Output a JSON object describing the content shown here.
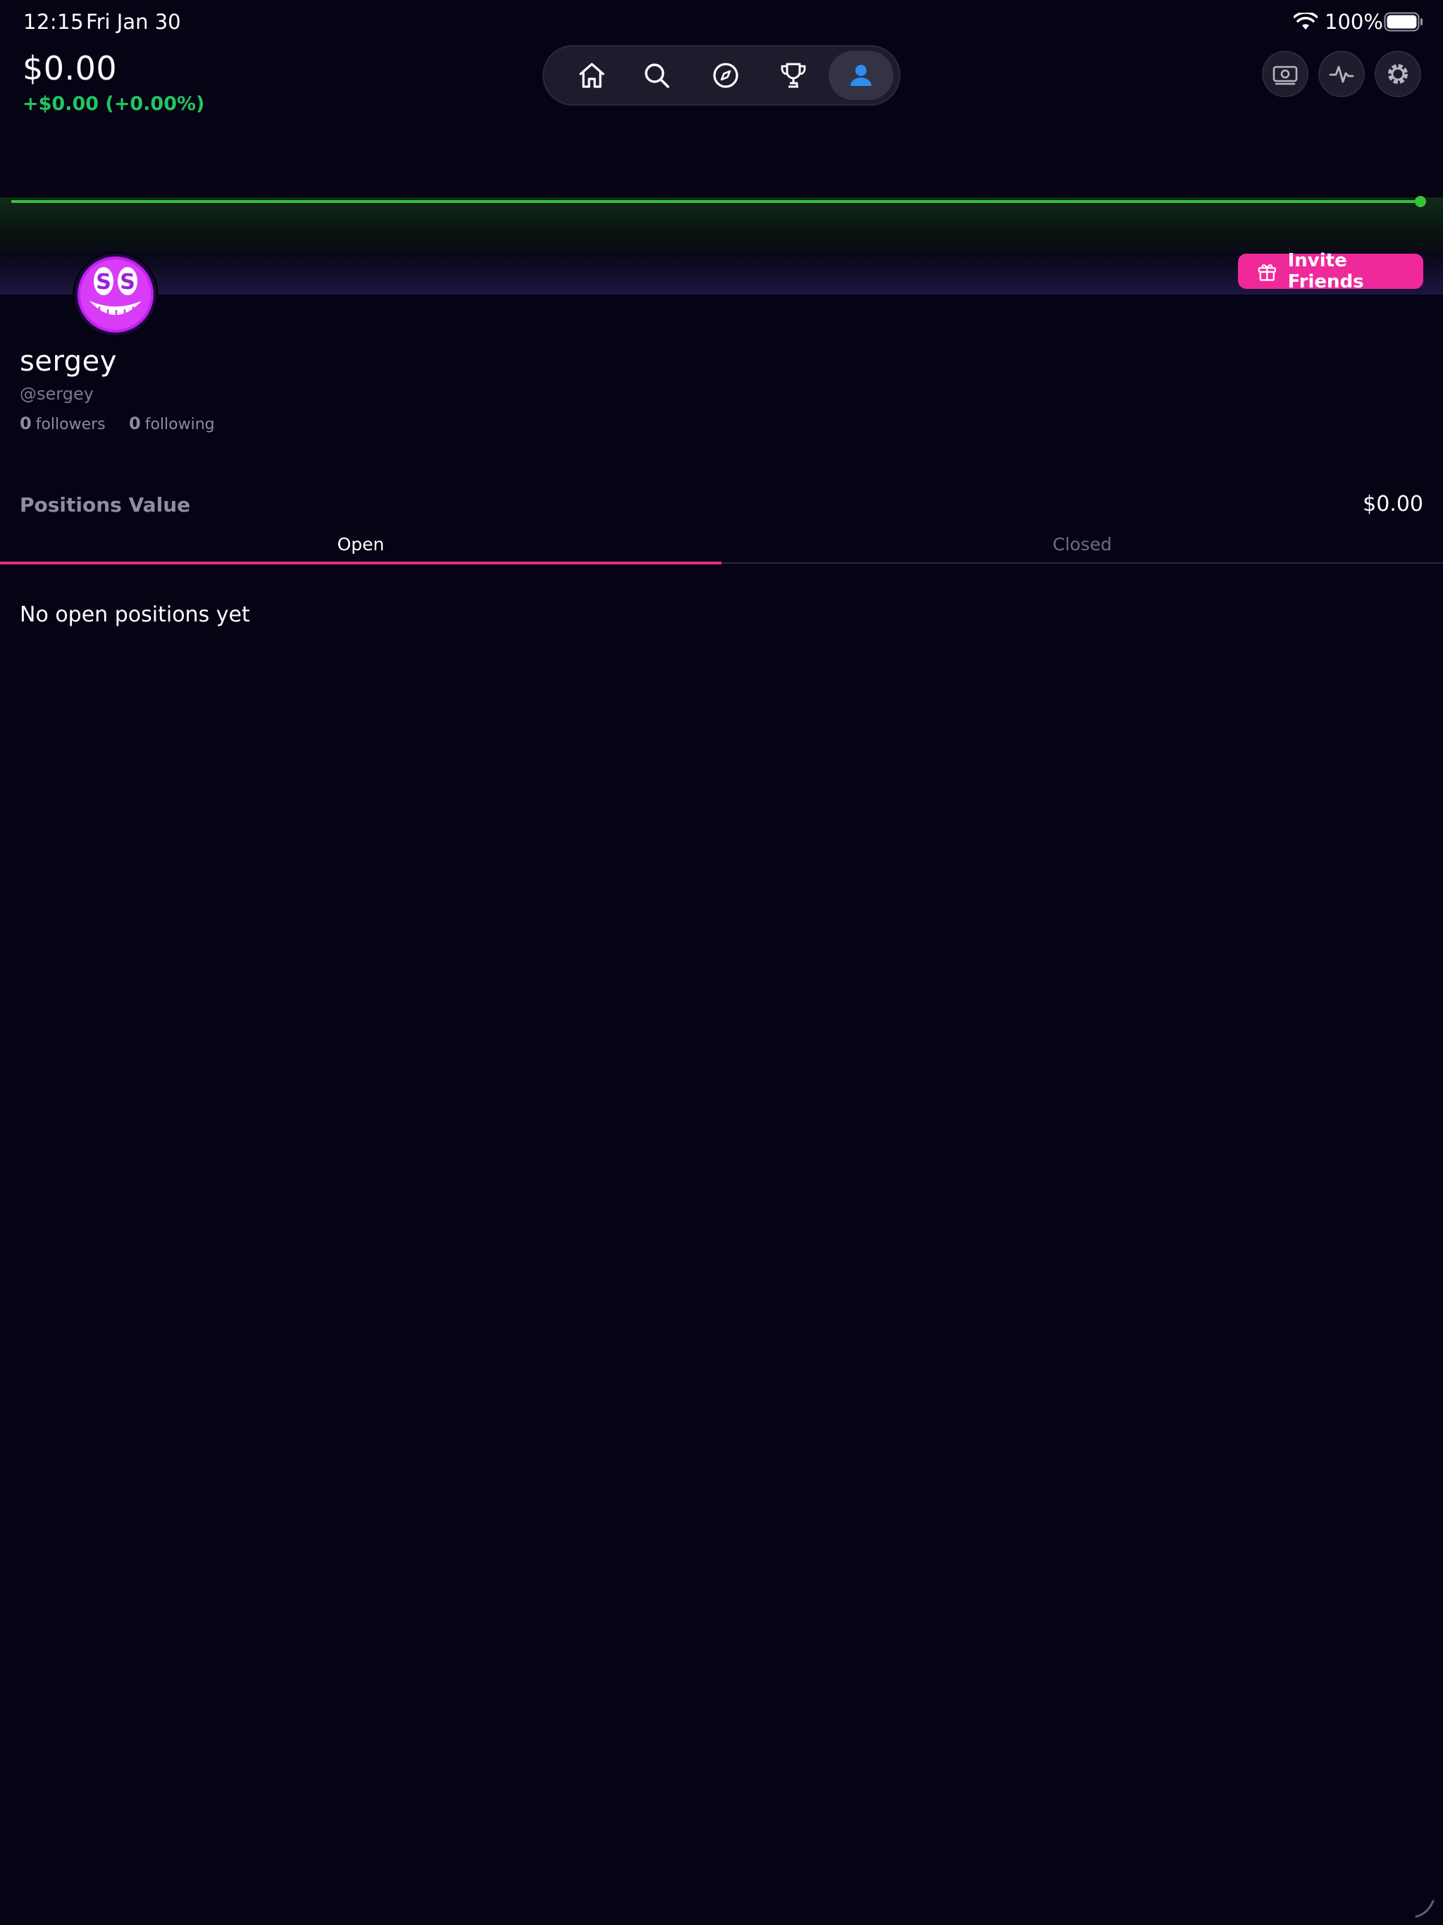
{
  "status_bar": {
    "time": "12:15",
    "date": "Fri Jan 30",
    "battery_pct": "100%"
  },
  "portfolio": {
    "balance": "$0.00",
    "change": "+$0.00 (+0.00%)",
    "change_color": "#22c55e"
  },
  "nav": {
    "items": [
      {
        "icon": "home-icon"
      },
      {
        "icon": "search-icon"
      },
      {
        "icon": "compass-icon"
      },
      {
        "icon": "trophy-icon"
      },
      {
        "icon": "profile-icon",
        "active": true
      }
    ],
    "active_color": "#2b8ef0"
  },
  "header_actions": [
    {
      "icon": "cash-icon"
    },
    {
      "icon": "activity-icon"
    },
    {
      "icon": "gear-icon"
    }
  ],
  "invite": {
    "label": "Invite Friends",
    "icon": "gift-icon",
    "color": "#f0299b"
  },
  "profile": {
    "name": "sergey",
    "handle": "@sergey",
    "followers_count": "0",
    "followers_label": "followers",
    "following_count": "0",
    "following_label": "following"
  },
  "positions": {
    "label": "Positions Value",
    "value": "$0.00",
    "tabs": [
      {
        "label": "Open",
        "active": true
      },
      {
        "label": "Closed",
        "active": false
      }
    ],
    "accent": "#e8307f",
    "empty_message": "No open positions yet"
  }
}
